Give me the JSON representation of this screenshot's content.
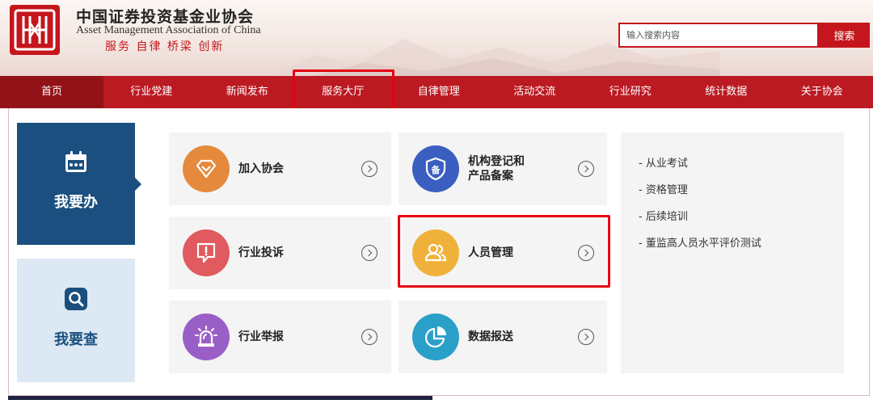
{
  "header": {
    "title_cn": "中国证券投资基金业协会",
    "title_en": "Asset Management Association of China",
    "slogan": "服务 自律 桥梁 创新",
    "search_placeholder": "输入搜索内容",
    "search_button": "搜索",
    "brand_color": "#c4161c"
  },
  "nav": {
    "items": [
      {
        "label": "首页"
      },
      {
        "label": "行业党建"
      },
      {
        "label": "新闻发布"
      },
      {
        "label": "服务大厅"
      },
      {
        "label": "自律管理"
      },
      {
        "label": "活动交流"
      },
      {
        "label": "行业研究"
      },
      {
        "label": "统计数据"
      },
      {
        "label": "关于协会"
      }
    ],
    "active": "服务大厅",
    "color": "#bb1a22"
  },
  "side_tabs": {
    "do": {
      "label": "我要办",
      "icon": "calendar-icon",
      "active": true,
      "color": "#1a4f7f"
    },
    "find": {
      "label": "我要查",
      "icon": "search-icon",
      "color": "#dce8f3"
    }
  },
  "services": [
    {
      "label": "加入协会",
      "icon": "diamond-icon",
      "color": "#e58a3c"
    },
    {
      "label_line1": "机构登记和",
      "label_line2": "产品备案",
      "icon": "shield-icon",
      "color": "#3a5fc0"
    },
    {
      "label": "行业投诉",
      "icon": "alert-icon",
      "color": "#e05a5f"
    },
    {
      "label": "人员管理",
      "icon": "people-icon",
      "color": "#f0b13a"
    },
    {
      "label": "行业举报",
      "icon": "siren-icon",
      "color": "#9a5fc7"
    },
    {
      "label": "数据报送",
      "icon": "pie-chart-icon",
      "color": "#2aa0c9"
    }
  ],
  "list": [
    {
      "label": "- 从业考试"
    },
    {
      "label": "- 资格管理"
    },
    {
      "label": "- 后续培训"
    },
    {
      "label": "- 董监高人员水平评价测试"
    }
  ]
}
